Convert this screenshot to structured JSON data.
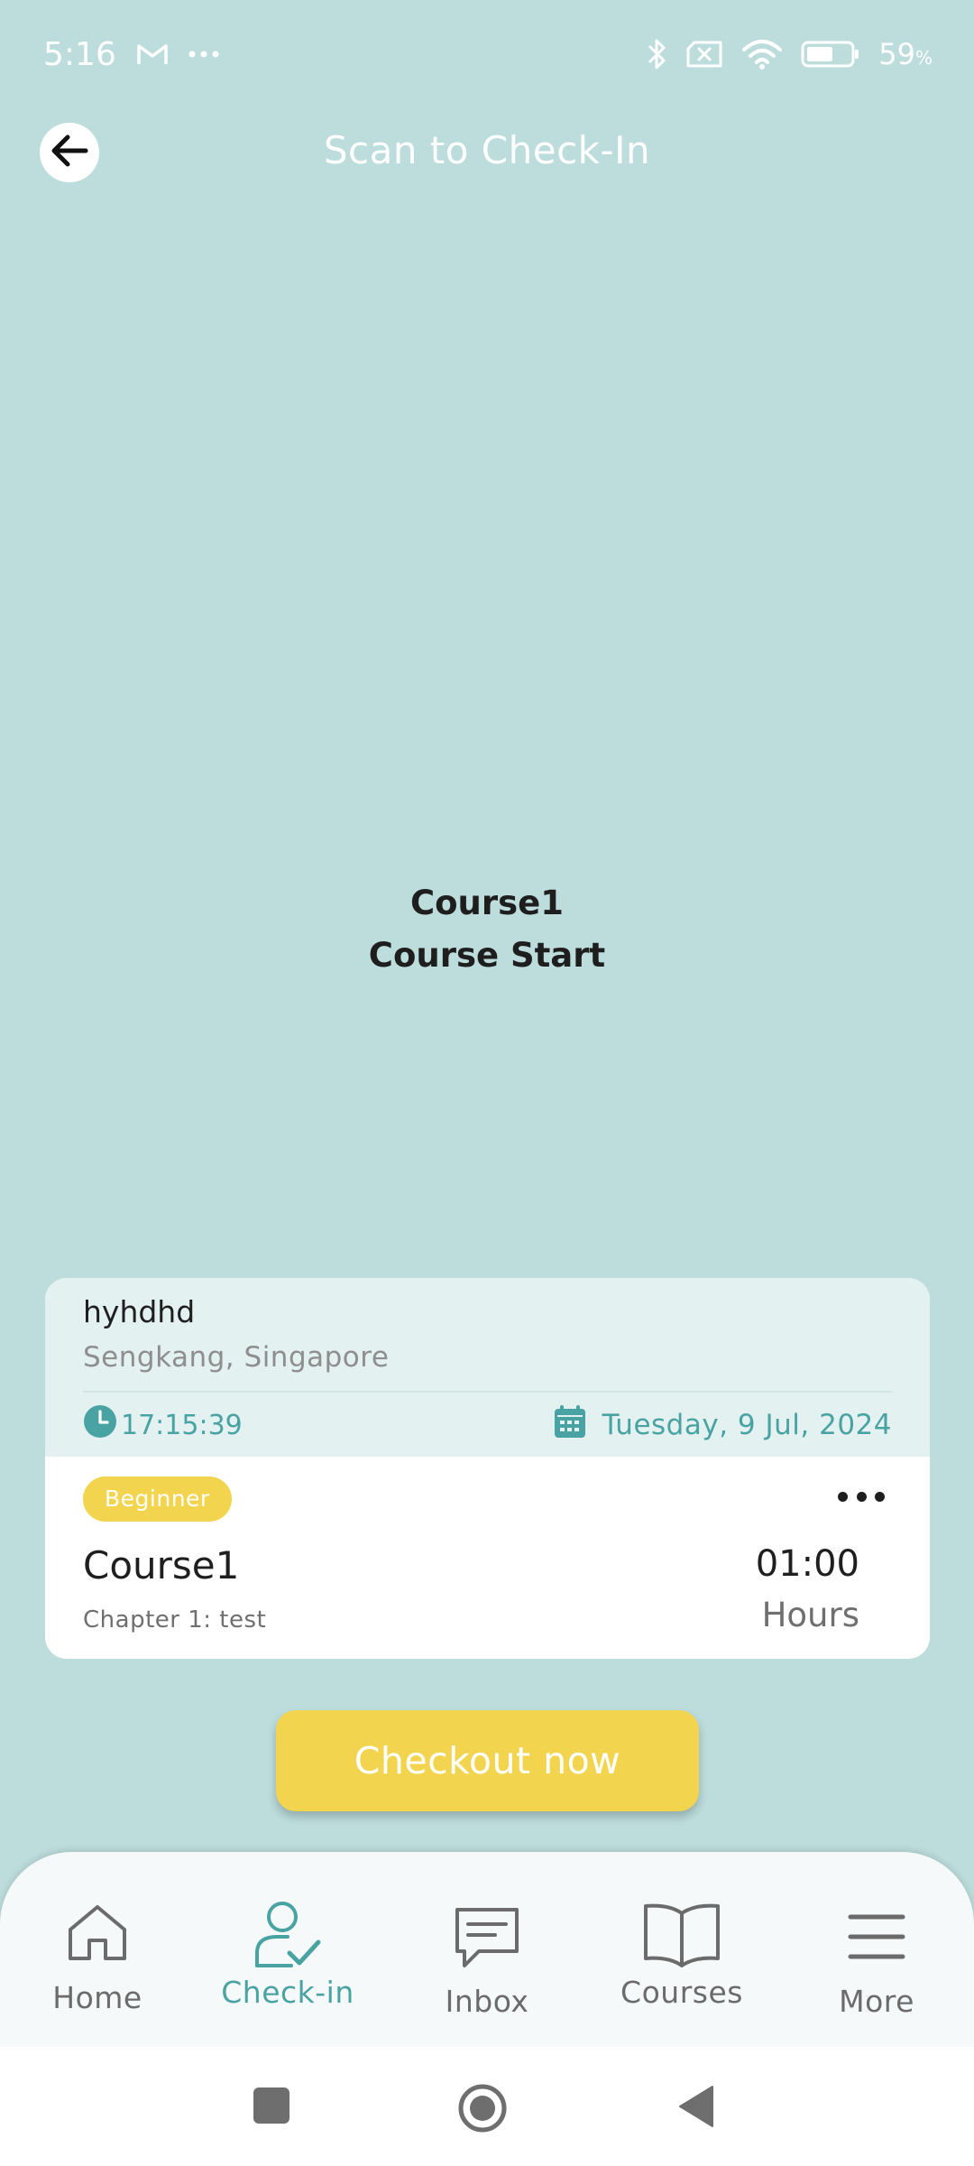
{
  "status_bar": {
    "time": "5:16",
    "notification_icons": [
      "gmail-icon",
      "more-dots-icon"
    ],
    "system_icons": [
      "bluetooth-icon",
      "no-sim-icon",
      "wifi-icon",
      "battery-icon"
    ],
    "battery_percent": "59",
    "battery_unit": "%",
    "battery_level": 0.59
  },
  "header": {
    "title": "Scan to Check-In",
    "back_icon": "arrow-left-icon"
  },
  "scan_info": {
    "course": "Course1",
    "status": "Course Start"
  },
  "session_card": {
    "student_name": "hyhdhd",
    "location": "Sengkang, Singapore",
    "time": "17:15:39",
    "date": "Tuesday, 9 Jul, 2024",
    "level": "Beginner",
    "course_name": "Course1",
    "chapter": "Chapter 1: test",
    "duration_value": "01:00",
    "duration_unit": "Hours"
  },
  "checkout_button": {
    "label": "Checkout now"
  },
  "bottom_nav": {
    "items": [
      {
        "label": "Home",
        "icon": "home-icon",
        "active": false
      },
      {
        "label": "Check-in",
        "icon": "user-check-icon",
        "active": true
      },
      {
        "label": "Inbox",
        "icon": "message-icon",
        "active": false
      },
      {
        "label": "Courses",
        "icon": "book-icon",
        "active": false
      },
      {
        "label": "More",
        "icon": "menu-icon",
        "active": false
      }
    ]
  },
  "system_nav": {
    "buttons": [
      "recents-square-icon",
      "home-circle-icon",
      "back-triangle-icon"
    ]
  },
  "colors": {
    "background": "#bddcdc",
    "accent_teal": "#4aa3a3",
    "accent_yellow": "#f3d44f",
    "card_header": "#e4f1f1"
  }
}
